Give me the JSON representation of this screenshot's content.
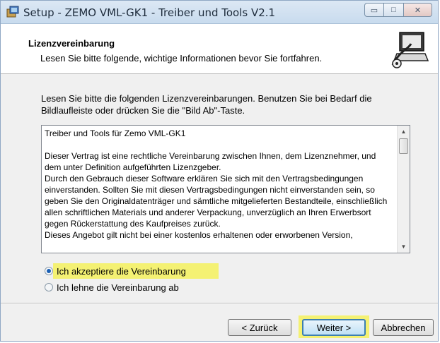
{
  "window": {
    "title": "Setup - ZEMO VML-GK1 - Treiber und Tools V2.1",
    "controls": {
      "minimize": "▭",
      "maximize": "□",
      "close": "✕"
    }
  },
  "header": {
    "title": "Lizenzvereinbarung",
    "subtitle": "Lesen Sie bitte folgende, wichtige Informationen bevor Sie fortfahren."
  },
  "intro": "Lesen Sie bitte die folgenden Lizenzvereinbarungen. Benutzen Sie bei Bedarf die Bildlaufleiste oder drücken Sie die \"Bild Ab\"-Taste.",
  "license": {
    "text": "Treiber und Tools für Zemo VML-GK1\n\nDieser Vertrag ist eine rechtliche Vereinbarung zwischen Ihnen, dem Lizenznehmer, und dem unter Definition aufgeführten Lizenzgeber.\nDurch den Gebrauch dieser Software erklären Sie sich mit den Vertragsbedingungen einverstanden. Sollten Sie mit diesen Vertragsbedingungen nicht einverstanden sein, so geben Sie den Originaldatenträger und sämtliche mitgelieferten Bestandteile, einschließlich allen schriftlichen Materials und anderer Verpackung, unverzüglich an Ihren Erwerbsort gegen Rückerstattung des Kaufpreises zurück.\nDieses Angebot gilt nicht bei einer kostenlos erhaltenen oder erworbenen Version,",
    "scroll_up": "▲",
    "scroll_down": "▼"
  },
  "radios": {
    "accept": {
      "label": "Ich akzeptiere die Vereinbarung",
      "selected": true
    },
    "decline": {
      "label": "Ich lehne die Vereinbarung ab",
      "selected": false
    }
  },
  "buttons": {
    "back": "< Zurück",
    "next": "Weiter >",
    "cancel": "Abbrechen"
  },
  "colors": {
    "highlight": "#f6f24a",
    "default_button_border": "#3c7fb1",
    "titlebar": "#c8dbee"
  },
  "icons": {
    "title": "setup-installer-icon",
    "header": "computer-installer-icon"
  }
}
